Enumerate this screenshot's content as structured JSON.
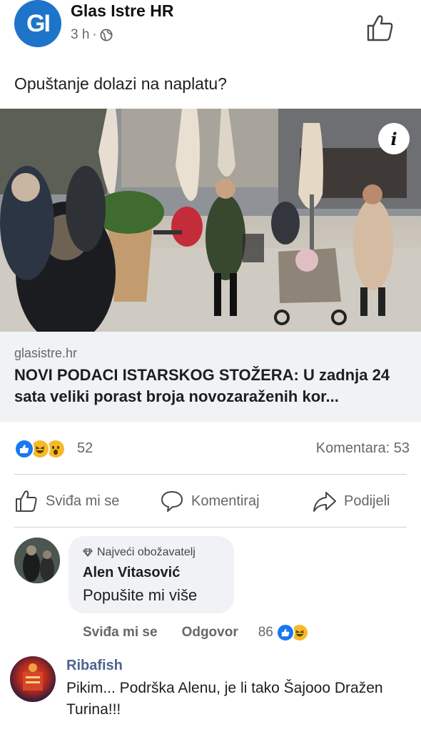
{
  "post": {
    "page_name": "Glas Istre HR",
    "avatar_text": "GI",
    "time": "3 h",
    "separator": "·",
    "text": "Opuštanje dolazi na naplatu?"
  },
  "link": {
    "domain": "glasistre.hr",
    "title": "NOVI PODACI ISTARSKOG STOŽERA: U zadnja 24 sata veliki porast broja novozaraženih kor...",
    "info_badge": "i"
  },
  "reactions": {
    "icons": [
      "like-icon",
      "haha-icon",
      "wow-icon"
    ],
    "count": "52",
    "comments": "Komentara: 53"
  },
  "actions": {
    "like": "Sviđa mi se",
    "comment": "Komentiraj",
    "share": "Podijeli"
  },
  "comment": {
    "badge": "Najveći obožavatelj",
    "name": "Alen Vitasović",
    "text": "Popušite mi više",
    "like_action": "Sviđa mi se",
    "reply_action": "Odgovor",
    "reaction_count": "86"
  },
  "reply": {
    "name": "Ribafish",
    "text": "Pikim... Podrška Alenu, je li tako Šajooo Dražen Turina!!!"
  },
  "colors": {
    "brand_blue": "#1e74c9",
    "like_blue": "#1877f2",
    "haha_yellow": "#f7b928",
    "muted_text": "#65676b",
    "link_bg": "#f0f2f5"
  }
}
